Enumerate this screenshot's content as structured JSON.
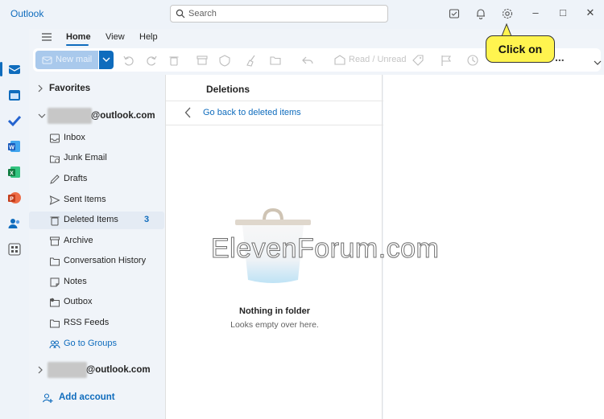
{
  "titlebar": {
    "app_title": "Outlook",
    "search_placeholder": "Search"
  },
  "ribbon": {
    "tabs": [
      "Home",
      "View",
      "Help"
    ],
    "new_mail_label": "New mail",
    "read_unread_label": "Read / Unread",
    "more_label": "..."
  },
  "folders": {
    "favorites_label": "Favorites",
    "account1_suffix": "@outlook.com",
    "account2_suffix": "@outlook.com",
    "items": [
      {
        "label": "Inbox",
        "icon": "inbox-icon"
      },
      {
        "label": "Junk Email",
        "icon": "junk-icon"
      },
      {
        "label": "Drafts",
        "icon": "pencil-icon"
      },
      {
        "label": "Sent Items",
        "icon": "send-icon"
      },
      {
        "label": "Deleted Items",
        "icon": "trash-icon",
        "count": "3"
      },
      {
        "label": "Archive",
        "icon": "archive-icon"
      },
      {
        "label": "Conversation History",
        "icon": "folder-icon"
      },
      {
        "label": "Notes",
        "icon": "note-icon"
      },
      {
        "label": "Outbox",
        "icon": "outbox-icon"
      },
      {
        "label": "RSS Feeds",
        "icon": "folder-icon"
      },
      {
        "label": "Go to Groups",
        "icon": "groups-icon"
      }
    ],
    "add_account_label": "Add account"
  },
  "list": {
    "title": "Deletions",
    "back_link": "Go back to deleted items",
    "empty_title": "Nothing in folder",
    "empty_subtitle": "Looks empty over here."
  },
  "annotations": {
    "callout_text": "Click on",
    "watermark_text": "ElevenForum.com"
  },
  "colors": {
    "accent": "#0f6cbd",
    "callout": "#fff44f"
  }
}
